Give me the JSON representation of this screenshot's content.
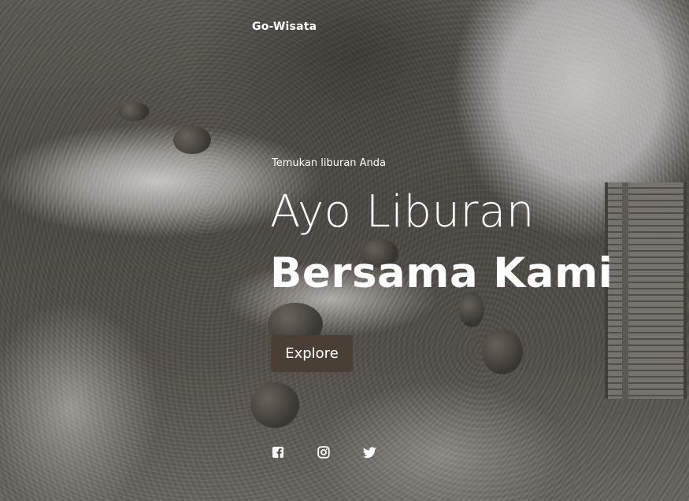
{
  "nav": {
    "brand": "Go-Wisata"
  },
  "hero": {
    "tagline": "Temukan liburan Anda",
    "headline_line1": "Ayo Liburan",
    "headline_line2": "Bersama Kami",
    "cta_label": "Explore"
  },
  "socials": [
    {
      "icon": "facebook-icon"
    },
    {
      "icon": "instagram-icon"
    },
    {
      "icon": "twitter-icon"
    }
  ],
  "colors": {
    "button_bg": "#4a3f35",
    "text": "#ffffff"
  }
}
